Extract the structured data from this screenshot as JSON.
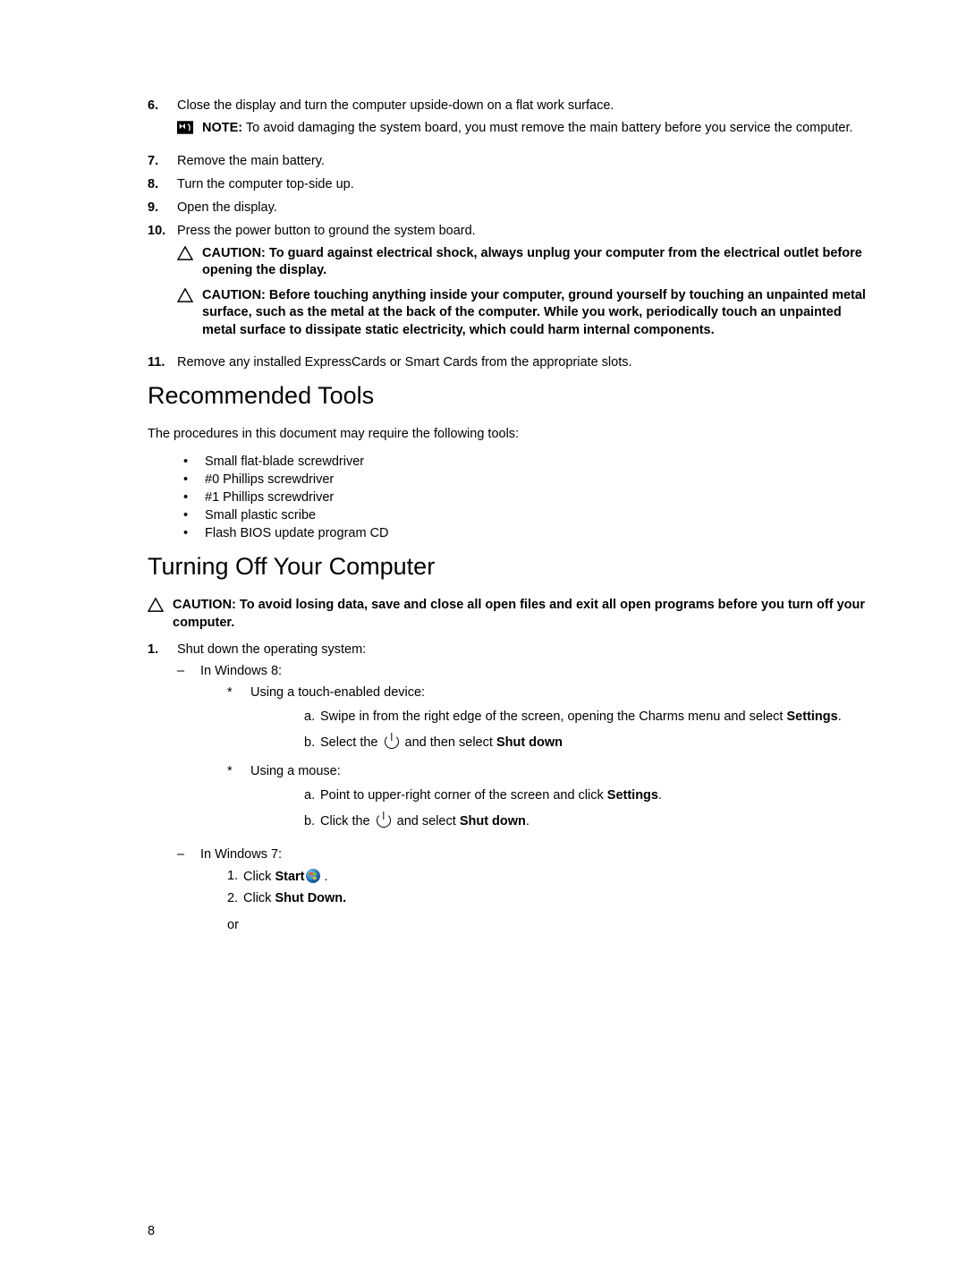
{
  "steps_top": [
    {
      "num": "6.",
      "text": "Close the display and turn the computer upside-down on a flat work surface."
    },
    {
      "num": "7.",
      "text": "Remove the main battery."
    },
    {
      "num": "8.",
      "text": "Turn the computer top-side up."
    },
    {
      "num": "9.",
      "text": "Open the display."
    },
    {
      "num": "10.",
      "text": "Press the power button to ground the system board."
    },
    {
      "num": "11.",
      "text": "Remove any installed ExpressCards or Smart Cards from the appropriate slots."
    }
  ],
  "note6": {
    "label": "NOTE:",
    "text": " To avoid damaging the system board, you must remove the main battery before you service the computer."
  },
  "caution10a": {
    "label": "CAUTION: ",
    "text": "To guard against electrical shock, always unplug your computer from the electrical outlet before opening the display."
  },
  "caution10b": {
    "label": "CAUTION: ",
    "text": "Before touching anything inside your computer, ground yourself by touching an unpainted metal surface, such as the metal at the back of the computer. While you work, periodically touch an unpainted metal surface to dissipate static electricity, which could harm internal components."
  },
  "h1_tools": "Recommended Tools",
  "tools_intro": "The procedures in this document may require the following tools:",
  "tools": [
    "Small flat-blade screwdriver",
    "#0 Phillips screwdriver",
    "#1 Phillips screwdriver",
    "Small plastic scribe",
    "Flash BIOS update program CD"
  ],
  "h1_turnoff": "Turning Off Your Computer",
  "caution_turnoff": {
    "label": "CAUTION: ",
    "text": "To avoid losing data, save and close all open files and exit all open programs before you turn off your computer."
  },
  "turnoff_step1_num": "1.",
  "turnoff_step1_text": "Shut down the operating system:",
  "win8_label": "In Windows 8:",
  "touch_label": "Using a touch-enabled device:",
  "touch_a_prefix": "Swipe in from the right edge of the screen, opening the Charms menu and select ",
  "touch_a_bold": "Settings",
  "touch_a_suffix": ".",
  "touch_b_prefix": "Select the ",
  "touch_b_mid": " and then select ",
  "touch_b_bold": "Shut down",
  "mouse_label": "Using a mouse:",
  "mouse_a_prefix": "Point to upper-right corner of the screen and click ",
  "mouse_a_bold": "Settings",
  "mouse_a_suffix": ".",
  "mouse_b_prefix": "Click the ",
  "mouse_b_mid": " and select ",
  "mouse_b_bold": "Shut down",
  "mouse_b_suffix": ".",
  "win7_label": "In Windows 7:",
  "win7_1_prefix": "Click ",
  "win7_1_bold": "Start",
  "win7_1_suffix": " .",
  "win7_2_prefix": "Click ",
  "win7_2_bold": "Shut Down.",
  "or_text": "or",
  "page_num": "8"
}
